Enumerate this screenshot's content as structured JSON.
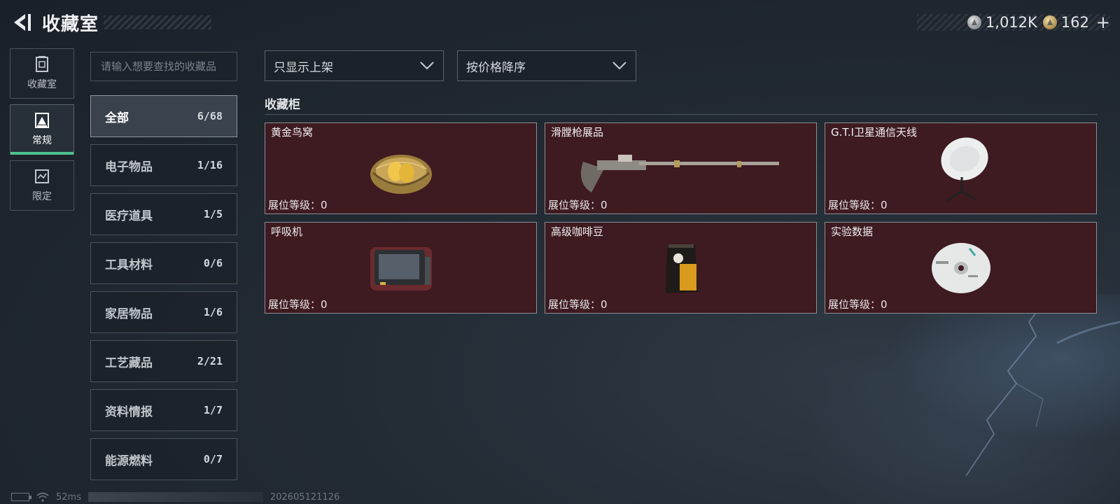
{
  "header": {
    "title": "收藏室",
    "currency": [
      {
        "icon": "silver-coin-icon",
        "value": "1,012K"
      },
      {
        "icon": "gold-coin-icon",
        "value": "162"
      }
    ],
    "add_label": "+"
  },
  "leftnav": {
    "items": [
      {
        "label": "收藏室",
        "icon": "collection-room-icon",
        "active": false
      },
      {
        "label": "常规",
        "icon": "regular-icon",
        "active": true
      },
      {
        "label": "限定",
        "icon": "limited-icon",
        "active": false
      }
    ]
  },
  "search": {
    "placeholder": "请输入想要查找的收藏品"
  },
  "categories": [
    {
      "label": "全部",
      "count": "6/68",
      "active": true
    },
    {
      "label": "电子物品",
      "count": "1/16"
    },
    {
      "label": "医疗道具",
      "count": "1/5"
    },
    {
      "label": "工具材料",
      "count": "0/6"
    },
    {
      "label": "家居物品",
      "count": "1/6"
    },
    {
      "label": "工艺藏品",
      "count": "2/21"
    },
    {
      "label": "资料情报",
      "count": "1/7"
    },
    {
      "label": "能源燃料",
      "count": "0/7"
    }
  ],
  "filters": {
    "display": "只显示上架",
    "sort": "按价格降序"
  },
  "cabinet": {
    "title": "收藏柜",
    "items": [
      {
        "name": "黄金鸟窝",
        "level": "展位等级：0",
        "icon": "golden-nest-icon"
      },
      {
        "name": "滑膛枪展品",
        "level": "展位等级：0",
        "icon": "musket-icon"
      },
      {
        "name": "G.T.I卫星通信天线",
        "level": "展位等级：0",
        "icon": "satellite-dish-icon"
      },
      {
        "name": "呼吸机",
        "level": "展位等级：0",
        "icon": "ventilator-icon"
      },
      {
        "name": "高级咖啡豆",
        "level": "展位等级：0",
        "icon": "coffee-bag-icon"
      },
      {
        "name": "实验数据",
        "level": "展位等级：0",
        "icon": "data-disc-icon"
      }
    ]
  },
  "statusbar": {
    "ping": "52ms",
    "build": "202605121126"
  },
  "colors": {
    "card_bg": "#3e1a21",
    "accent": "#4fc38e"
  }
}
